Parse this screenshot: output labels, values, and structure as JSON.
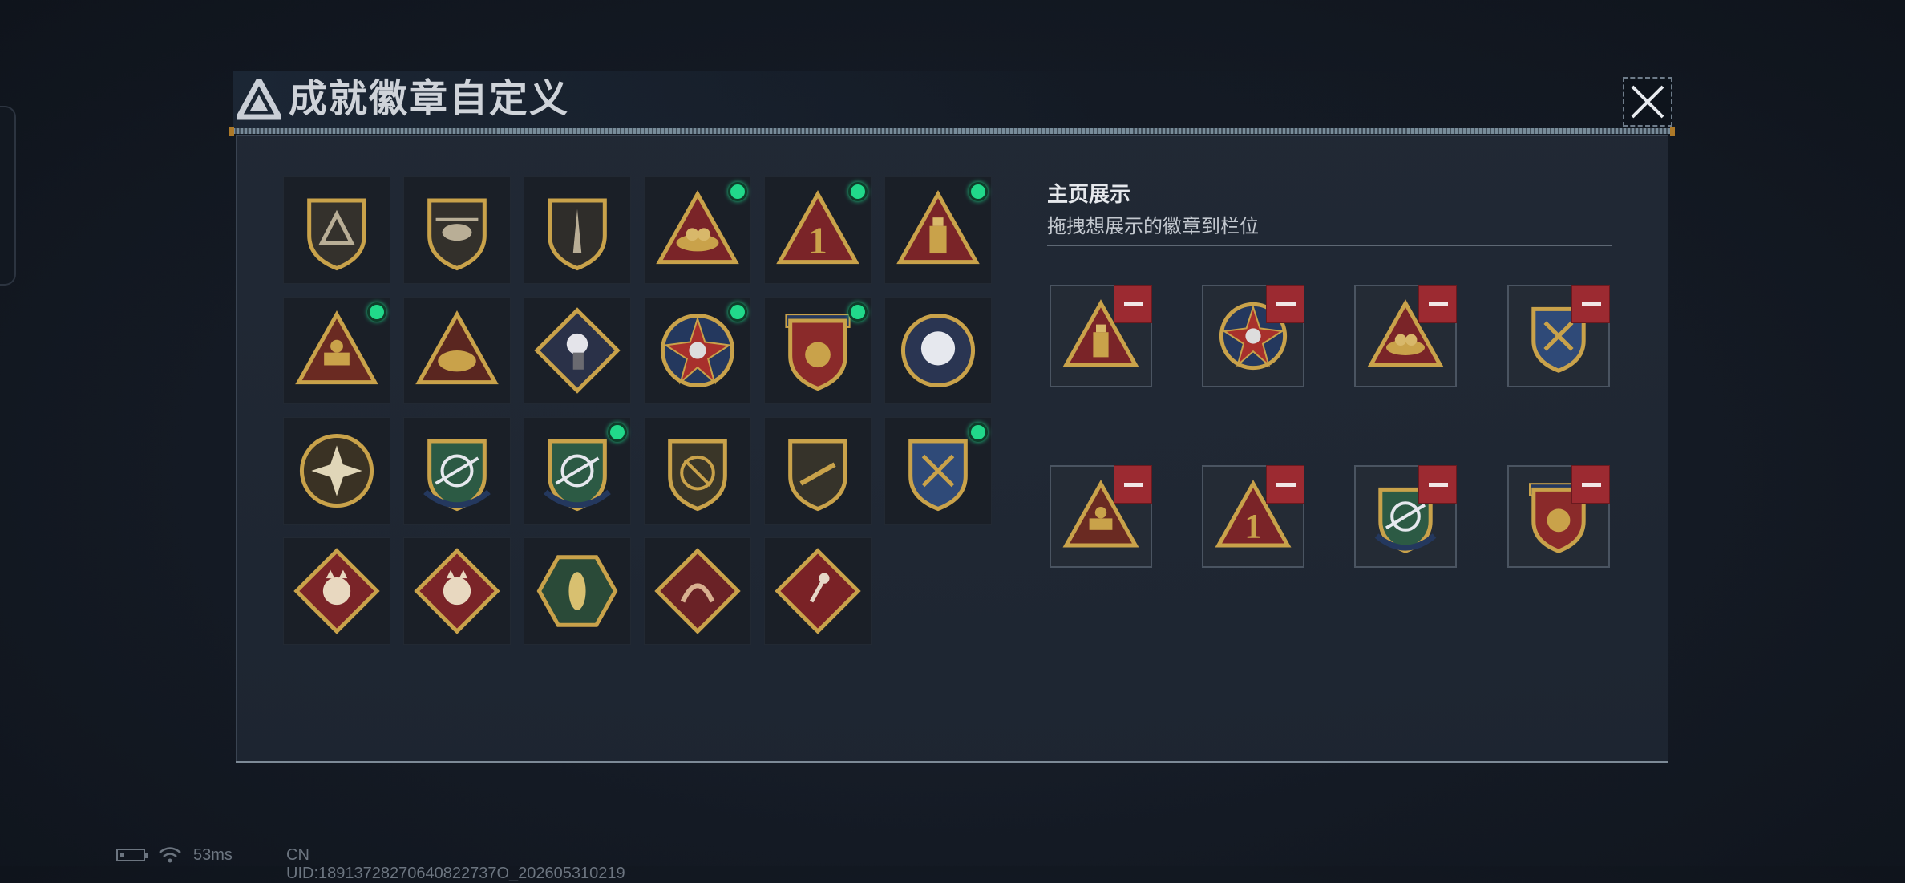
{
  "dialog": {
    "title": "成就徽章自定义",
    "close_icon": "close-icon"
  },
  "grid": {
    "badges": [
      {
        "id": 1,
        "icon": "triangle-shield-badge",
        "new": false
      },
      {
        "id": 2,
        "icon": "helicopter-shield-badge",
        "new": false
      },
      {
        "id": 3,
        "icon": "dagger-shield-badge",
        "new": false
      },
      {
        "id": 4,
        "icon": "eggs-nest-triangle-badge",
        "new": true
      },
      {
        "id": 5,
        "icon": "number-one-triangle-badge",
        "new": true
      },
      {
        "id": 6,
        "icon": "usb-triangle-badge",
        "new": true
      },
      {
        "id": 7,
        "icon": "tank-triangle-badge",
        "new": true
      },
      {
        "id": 8,
        "icon": "elephants-triangle-badge",
        "new": false
      },
      {
        "id": 9,
        "icon": "rose-diamond-badge",
        "new": false
      },
      {
        "id": 10,
        "icon": "star-skull-round-badge",
        "new": true
      },
      {
        "id": 11,
        "icon": "emblem-ribbon-badge",
        "new": true
      },
      {
        "id": 12,
        "icon": "white-rose-round-badge",
        "new": false
      },
      {
        "id": 13,
        "icon": "sunburst-round-badge",
        "new": false
      },
      {
        "id": 14,
        "icon": "rifle-target-shield-badge",
        "new": false
      },
      {
        "id": 15,
        "icon": "rifle-target-shield-badge-2",
        "new": true
      },
      {
        "id": 16,
        "icon": "no-rifle-shield-badge",
        "new": false
      },
      {
        "id": 17,
        "icon": "rifle-shield-badge",
        "new": false
      },
      {
        "id": 18,
        "icon": "crossed-weapons-shield-badge",
        "new": true
      },
      {
        "id": 19,
        "icon": "wolf-diamond-badge",
        "new": false
      },
      {
        "id": 20,
        "icon": "wolf-diamond-badge-2",
        "new": false
      },
      {
        "id": 21,
        "icon": "wasp-hexagon-badge",
        "new": false
      },
      {
        "id": 22,
        "icon": "dragon-diamond-badge",
        "new": false
      },
      {
        "id": 23,
        "icon": "runner-diamond-badge",
        "new": false
      }
    ]
  },
  "showcase": {
    "title": "主页展示",
    "subtitle": "拖拽想展示的徽章到栏位",
    "slots": [
      {
        "icon": "usb-triangle-badge"
      },
      {
        "icon": "star-skull-round-badge"
      },
      {
        "icon": "eggs-nest-triangle-badge"
      },
      {
        "icon": "crossed-weapons-shield-badge"
      },
      {
        "icon": "tank-triangle-badge"
      },
      {
        "icon": "number-one-triangle-badge"
      },
      {
        "icon": "rifle-target-shield-badge-2"
      },
      {
        "icon": "emblem-ribbon-badge"
      }
    ]
  },
  "status_bar": {
    "ping": "53ms",
    "uid": "CN UID:18913728270640822737O_202605310219"
  },
  "colors": {
    "new_dot": "#21d98a",
    "remove_button": "#9c2a31",
    "gold": "#c9a24a",
    "dark_red": "#7a2428"
  }
}
